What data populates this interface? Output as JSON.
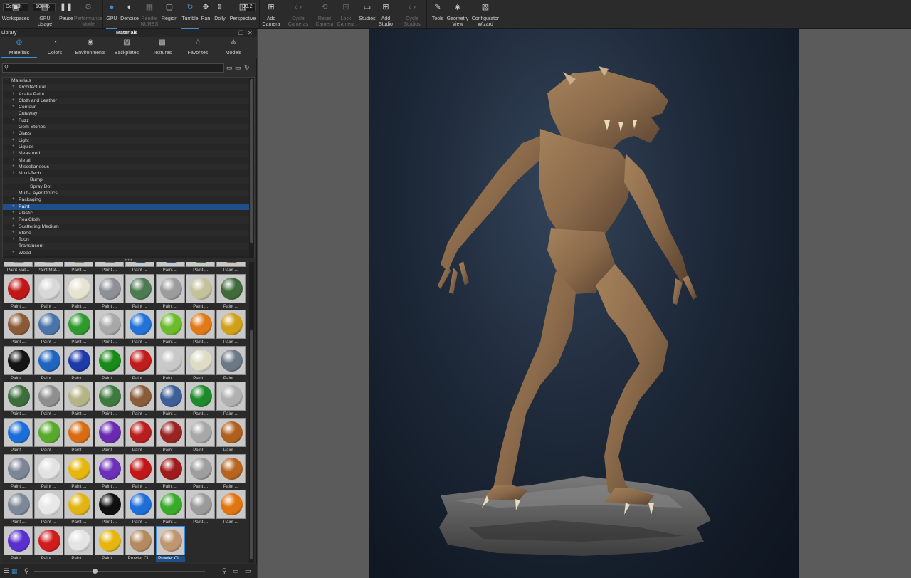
{
  "toolbar": {
    "workspace_value": "Default",
    "gpu_usage_value": "100 %",
    "perspective_value": "93.2",
    "buttons": [
      {
        "key": "workspaces",
        "label": "Workspaces",
        "icon": "workspaces-icon",
        "dim": false,
        "active": false
      },
      {
        "key": "gpu-usage",
        "label": "GPU Usage",
        "icon": "gpu-usage-icon",
        "dim": false,
        "active": false
      },
      {
        "key": "pause",
        "label": "Pause",
        "icon": "pause-icon",
        "dim": false,
        "active": false
      },
      {
        "key": "performance-mode",
        "label": "Performance\nMode",
        "icon": "performance-mode-icon",
        "dim": true,
        "active": false
      },
      {
        "key": "gpu",
        "label": "GPU",
        "icon": "gpu-icon",
        "dim": false,
        "active": true
      },
      {
        "key": "denoise",
        "label": "Denoise",
        "icon": "denoise-icon",
        "dim": false,
        "active": false
      },
      {
        "key": "render-nurbs",
        "label": "Render\nNURBS",
        "icon": "render-nurbs-icon",
        "dim": true,
        "active": false
      },
      {
        "key": "region",
        "label": "Region",
        "icon": "region-icon",
        "dim": false,
        "active": false
      },
      {
        "key": "tumble",
        "label": "Tumble",
        "icon": "tumble-icon",
        "dim": false,
        "active": true
      },
      {
        "key": "pan",
        "label": "Pan",
        "icon": "pan-icon",
        "dim": false,
        "active": false
      },
      {
        "key": "dolly",
        "label": "Dolly",
        "icon": "dolly-icon",
        "dim": false,
        "active": false
      },
      {
        "key": "perspective",
        "label": "Perspective",
        "icon": "perspective-icon",
        "dim": false,
        "active": false
      },
      {
        "key": "add-camera",
        "label": "Add\nCamera",
        "icon": "add-camera-icon",
        "dim": false,
        "active": false
      },
      {
        "key": "cycle-cameras",
        "label": "Cycle\nCameras",
        "icon": "cycle-cameras-icon",
        "dim": true,
        "active": false
      },
      {
        "key": "reset-camera",
        "label": "Reset\nCamera",
        "icon": "reset-camera-icon",
        "dim": true,
        "active": false
      },
      {
        "key": "lock-camera",
        "label": "Lock\nCamera",
        "icon": "lock-camera-icon",
        "dim": true,
        "active": false
      },
      {
        "key": "studios",
        "label": "Studios",
        "icon": "studios-icon",
        "dim": false,
        "active": false
      },
      {
        "key": "add-studio",
        "label": "Add\nStudio",
        "icon": "add-studio-icon",
        "dim": false,
        "active": false
      },
      {
        "key": "cycle-studios",
        "label": "Cycle\nStudios",
        "icon": "cycle-studios-icon",
        "dim": true,
        "active": false
      },
      {
        "key": "tools",
        "label": "Tools",
        "icon": "tools-icon",
        "dim": false,
        "active": false
      },
      {
        "key": "geometry-view",
        "label": "Geometry\nView",
        "icon": "geometry-view-icon",
        "dim": false,
        "active": false
      },
      {
        "key": "configurator-wizard",
        "label": "Configurator\nWizard",
        "icon": "configurator-wizard-icon",
        "dim": false,
        "active": false
      }
    ]
  },
  "library": {
    "label": "Library",
    "title": "Materials",
    "tabs": [
      {
        "label": "Materials",
        "icon": "materials-icon",
        "active": true
      },
      {
        "label": "Colors",
        "icon": "colors-icon",
        "active": false
      },
      {
        "label": "Environments",
        "icon": "environments-icon",
        "active": false
      },
      {
        "label": "Backplates",
        "icon": "backplates-icon",
        "active": false
      },
      {
        "label": "Textures",
        "icon": "textures-icon",
        "active": false
      },
      {
        "label": "Favorites",
        "icon": "favorites-icon",
        "active": false
      },
      {
        "label": "Models",
        "icon": "models-icon",
        "active": false
      }
    ],
    "search_value": "",
    "tree": [
      {
        "label": "Materials",
        "level": 0,
        "expandable": true,
        "selected": false
      },
      {
        "label": "Architectural",
        "level": 1,
        "expandable": true,
        "selected": false
      },
      {
        "label": "Axalta Paint",
        "level": 1,
        "expandable": true,
        "selected": false
      },
      {
        "label": "Cloth and Leather",
        "level": 1,
        "expandable": true,
        "selected": false
      },
      {
        "label": "Contour",
        "level": 1,
        "expandable": true,
        "selected": false
      },
      {
        "label": "Cutaway",
        "level": 1,
        "expandable": false,
        "selected": false
      },
      {
        "label": "Fuzz",
        "level": 1,
        "expandable": true,
        "selected": false
      },
      {
        "label": "Gem Stones",
        "level": 1,
        "expandable": false,
        "selected": false
      },
      {
        "label": "Glass",
        "level": 1,
        "expandable": true,
        "selected": false
      },
      {
        "label": "Light",
        "level": 1,
        "expandable": true,
        "selected": false
      },
      {
        "label": "Liquids",
        "level": 1,
        "expandable": true,
        "selected": false
      },
      {
        "label": "Measured",
        "level": 1,
        "expandable": true,
        "selected": false
      },
      {
        "label": "Metal",
        "level": 1,
        "expandable": true,
        "selected": false
      },
      {
        "label": "Miscellaneous",
        "level": 1,
        "expandable": true,
        "selected": false
      },
      {
        "label": "Mold-Tech",
        "level": 1,
        "expandable": true,
        "selected": false
      },
      {
        "label": "Bump",
        "level": 2,
        "expandable": false,
        "selected": false
      },
      {
        "label": "Spray Dot",
        "level": 2,
        "expandable": false,
        "selected": false
      },
      {
        "label": "Multi-Layer Optics",
        "level": 1,
        "expandable": false,
        "selected": false
      },
      {
        "label": "Packaging",
        "level": 1,
        "expandable": true,
        "selected": false
      },
      {
        "label": "Paint",
        "level": 1,
        "expandable": true,
        "selected": true
      },
      {
        "label": "Plastic",
        "level": 1,
        "expandable": true,
        "selected": false
      },
      {
        "label": "RealCloth",
        "level": 1,
        "expandable": true,
        "selected": false
      },
      {
        "label": "Scattering Medium",
        "level": 1,
        "expandable": true,
        "selected": false
      },
      {
        "label": "Stone",
        "level": 1,
        "expandable": true,
        "selected": false
      },
      {
        "label": "Toon",
        "level": 1,
        "expandable": true,
        "selected": false
      },
      {
        "label": "Translucent",
        "level": 1,
        "expandable": false,
        "selected": false
      },
      {
        "label": "Wood",
        "level": 1,
        "expandable": true,
        "selected": false
      }
    ],
    "swatches": [
      {
        "caption": "Paint Mat...",
        "color": "#9a9a9a"
      },
      {
        "caption": "Paint Mat...",
        "color": "#a8a8a8"
      },
      {
        "caption": "Paint ...",
        "color": "#b09a60"
      },
      {
        "caption": "Paint ...",
        "color": "#8a8a8a"
      },
      {
        "caption": "Paint ...",
        "color": "#3060b0"
      },
      {
        "caption": "Paint ...",
        "color": "#3a5ab0"
      },
      {
        "caption": "Paint ...",
        "color": "#4a8a3a"
      },
      {
        "caption": "Paint ...",
        "color": "#a06040"
      },
      {
        "caption": "Paint ...",
        "color": "#c01818"
      },
      {
        "caption": "Paint ...",
        "color": "#d8d8d8"
      },
      {
        "caption": "Paint ...",
        "color": "#e6e4d0"
      },
      {
        "caption": "Paint ...",
        "color": "#8d9196"
      },
      {
        "caption": "Paint ...",
        "color": "#4e7a52"
      },
      {
        "caption": "Paint ...",
        "color": "#9c9c9c"
      },
      {
        "caption": "Paint ...",
        "color": "#c3c29a"
      },
      {
        "caption": "Paint ...",
        "color": "#3f6b3a"
      },
      {
        "caption": "Paint ...",
        "color": "#8a5a36"
      },
      {
        "caption": "Paint ...",
        "color": "#4a74a8"
      },
      {
        "caption": "Paint ...",
        "color": "#2e9a2e"
      },
      {
        "caption": "Paint ...",
        "color": "#a8a8a8"
      },
      {
        "caption": "Paint ...",
        "color": "#2272d8"
      },
      {
        "caption": "Paint ...",
        "color": "#6cbb2a"
      },
      {
        "caption": "Paint ...",
        "color": "#e07a18"
      },
      {
        "caption": "Paint ...",
        "color": "#d0a018"
      },
      {
        "caption": "Paint ...",
        "color": "#141414"
      },
      {
        "caption": "Paint ...",
        "color": "#1e64c0"
      },
      {
        "caption": "Paint ...",
        "color": "#1c3aa8"
      },
      {
        "caption": "Paint ...",
        "color": "#178a17"
      },
      {
        "caption": "Paint ...",
        "color": "#c01c1c"
      },
      {
        "caption": "Paint ...",
        "color": "#c8c8c8"
      },
      {
        "caption": "Paint ...",
        "color": "#dedcc4"
      },
      {
        "caption": "Paint ...",
        "color": "#6c7884"
      },
      {
        "caption": "Paint ...",
        "color": "#3c6e3c"
      },
      {
        "caption": "Paint ...",
        "color": "#8e8e8e"
      },
      {
        "caption": "Paint ...",
        "color": "#b4b488"
      },
      {
        "caption": "Paint ...",
        "color": "#3e7a3e"
      },
      {
        "caption": "Paint ...",
        "color": "#8a5c3a"
      },
      {
        "caption": "Paint ...",
        "color": "#3e5e98"
      },
      {
        "caption": "Paint ...",
        "color": "#1f8a2a"
      },
      {
        "caption": "Paint ...",
        "color": "#b0b0b0"
      },
      {
        "caption": "Paint ...",
        "color": "#1a6ed8"
      },
      {
        "caption": "Paint ...",
        "color": "#58aa2a"
      },
      {
        "caption": "Paint ...",
        "color": "#d86c14"
      },
      {
        "caption": "Paint ...",
        "color": "#6a2ab0"
      },
      {
        "caption": "Paint ...",
        "color": "#b81e1e"
      },
      {
        "caption": "Paint ...",
        "color": "#9a2424"
      },
      {
        "caption": "Paint ...",
        "color": "#a8a8a8"
      },
      {
        "caption": "Paint ...",
        "color": "#b0601e"
      },
      {
        "caption": "Paint ...",
        "color": "#7c8696"
      },
      {
        "caption": "Paint ...",
        "color": "#e2e2e2"
      },
      {
        "caption": "Paint ...",
        "color": "#e6b60e"
      },
      {
        "caption": "Paint ...",
        "color": "#6c30b8"
      },
      {
        "caption": "Paint ...",
        "color": "#c01818"
      },
      {
        "caption": "Paint ...",
        "color": "#a01c1c"
      },
      {
        "caption": "Paint ...",
        "color": "#9e9e9e"
      },
      {
        "caption": "Paint ...",
        "color": "#b86420"
      },
      {
        "caption": "Paint ...",
        "color": "#7c8898"
      },
      {
        "caption": "Paint ...",
        "color": "#e8e8e8"
      },
      {
        "caption": "Paint ...",
        "color": "#e0b412"
      },
      {
        "caption": "Paint ...",
        "color": "#101010"
      },
      {
        "caption": "Paint ...",
        "color": "#1e6ed8"
      },
      {
        "caption": "Paint ...",
        "color": "#3aaa2a"
      },
      {
        "caption": "Paint ...",
        "color": "#9a9a9a"
      },
      {
        "caption": "Paint ...",
        "color": "#e0740e"
      },
      {
        "caption": "Paint ...",
        "color": "#5a2ed0"
      },
      {
        "caption": "Paint ...",
        "color": "#d01c1c"
      },
      {
        "caption": "Paint ...",
        "color": "#e4e4e4"
      },
      {
        "caption": "Paint ...",
        "color": "#e6b60e"
      },
      {
        "caption": "Prowler Cl...",
        "color": "#b58a60"
      },
      {
        "caption": "Prowler Cl...",
        "color": "#c09670"
      }
    ],
    "selected_swatch": 69
  },
  "colors": {
    "accent": "#3a8fd8",
    "selection": "#1f4f86",
    "toolbar_bg": "#2b2b2b",
    "viewport_bg": "#5b5b5b",
    "render_bg": "#1a2433",
    "creature_skin": "#8a6a4a",
    "rock": "#5e5e5e"
  }
}
